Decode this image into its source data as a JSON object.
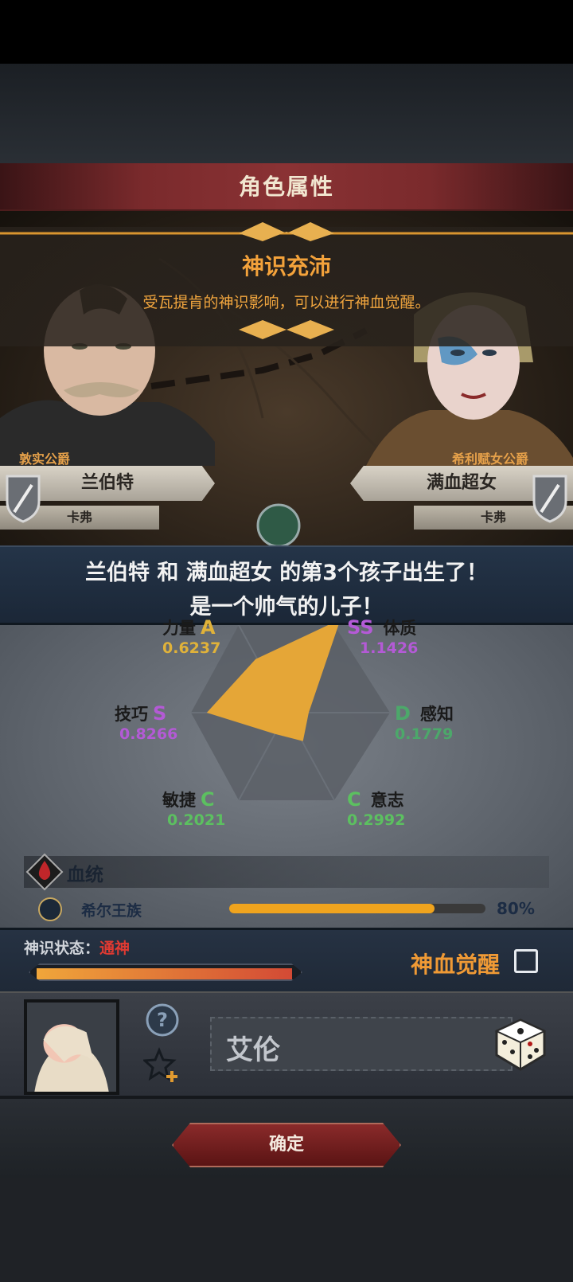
{
  "header": {
    "title": "角色属性"
  },
  "banner": {
    "title": "神识充沛",
    "subtitle": "受瓦提肯的神识影响，可以进行神血觉醒。"
  },
  "father": {
    "title": "敦实公爵",
    "name": "兰伯特",
    "region": "卡弗"
  },
  "mother": {
    "title": "希利赋女公爵",
    "name": "满血超女",
    "region": "卡弗"
  },
  "message": {
    "line1": "兰伯特 和 满血超女 的第3个孩子出生了！",
    "line2": "是一个帅气的儿子！"
  },
  "stats": [
    {
      "name": "力量",
      "grade": "A",
      "value": "0.6237",
      "grade_color": "#e0b23a"
    },
    {
      "name": "体质",
      "grade": "SS",
      "value": "1.1426",
      "grade_color": "#b45ad6"
    },
    {
      "name": "感知",
      "grade": "D",
      "value": "0.1779",
      "grade_color": "#4ca86a"
    },
    {
      "name": "意志",
      "grade": "C",
      "value": "0.2992",
      "grade_color": "#5cc060"
    },
    {
      "name": "敏捷",
      "grade": "C",
      "value": "0.2021",
      "grade_color": "#5cc060"
    },
    {
      "name": "技巧",
      "grade": "S",
      "value": "0.8266",
      "grade_color": "#b45ad6"
    }
  ],
  "bloodline": {
    "label": "血统",
    "items": [
      {
        "name": "希尔王族",
        "percent_label": "80%",
        "fraction": 0.8
      }
    ]
  },
  "divine": {
    "label": "神识状态：",
    "value": "通神",
    "fraction": 0.98,
    "awaken_label": "神血觉醒"
  },
  "naming": {
    "name": "艾伦"
  },
  "footer": {
    "confirm_label": "确定"
  },
  "icons": {
    "help": "question-icon",
    "favorite": "star-plus-icon",
    "random": "dice-icon",
    "blood": "blood-drop-icon",
    "bloodline_item": "skull-emblem-icon"
  }
}
